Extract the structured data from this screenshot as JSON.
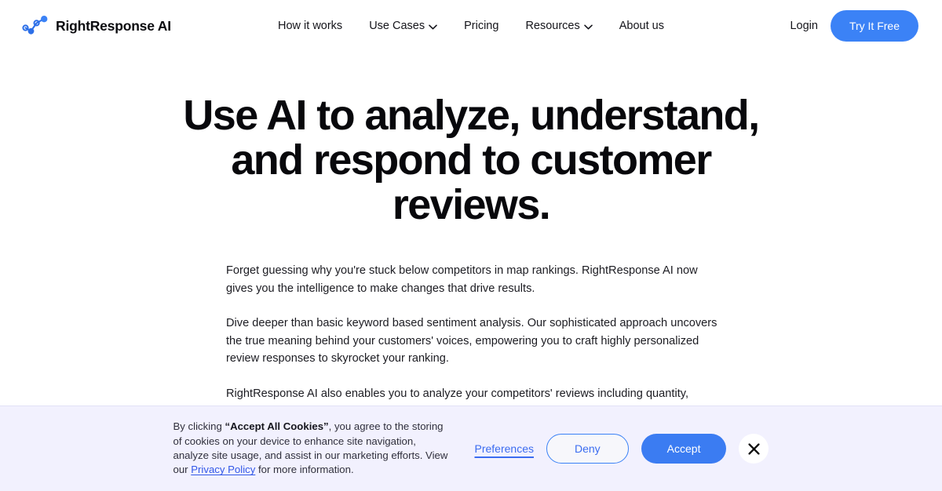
{
  "header": {
    "brand_name": "RightResponse AI",
    "nav_items": [
      {
        "label": "How it works",
        "has_dropdown": false
      },
      {
        "label": "Use Cases",
        "has_dropdown": true
      },
      {
        "label": "Pricing",
        "has_dropdown": false
      },
      {
        "label": "Resources",
        "has_dropdown": true
      },
      {
        "label": "About us",
        "has_dropdown": false
      }
    ],
    "login_label": "Login",
    "cta_label": "Try It Free"
  },
  "hero": {
    "title": "Use AI to analyze, understand, and respond to customer reviews.",
    "paragraphs": [
      "Forget guessing why you're stuck below competitors in map rankings. RightResponse AI now gives you the intelligence to make changes that drive results.",
      "Dive deeper than basic keyword based sentiment analysis. Our sophisticated approach uncovers the true meaning behind your customers' voices, empowering you to craft highly personalized review responses to skyrocket your ranking.",
      "RightResponse AI also enables you to analyze your competitors' reviews including quantity, recency, response rate, and sentiment to gain insight into their business, and then we help you build a true"
    ]
  },
  "cookie_banner": {
    "text_part_1": "By clicking ",
    "text_bold": "“Accept All Cookies”",
    "text_part_2": ", you agree to the storing of cookies on your device to enhance site navigation, analyze site usage, and assist in our marketing efforts. View our ",
    "privacy_link_label": "Privacy Policy",
    "text_part_3": " for more information.",
    "preferences_label": "Preferences",
    "deny_label": "Deny",
    "accept_label": "Accept",
    "close_label": "close-icon"
  },
  "colors": {
    "accent_blue": "#3B82F6",
    "accept_blue": "#3B7CF2",
    "link_blue": "#3B6CF0",
    "banner_bg": "#F2F1FE",
    "text_dark": "#0b0b0f"
  }
}
